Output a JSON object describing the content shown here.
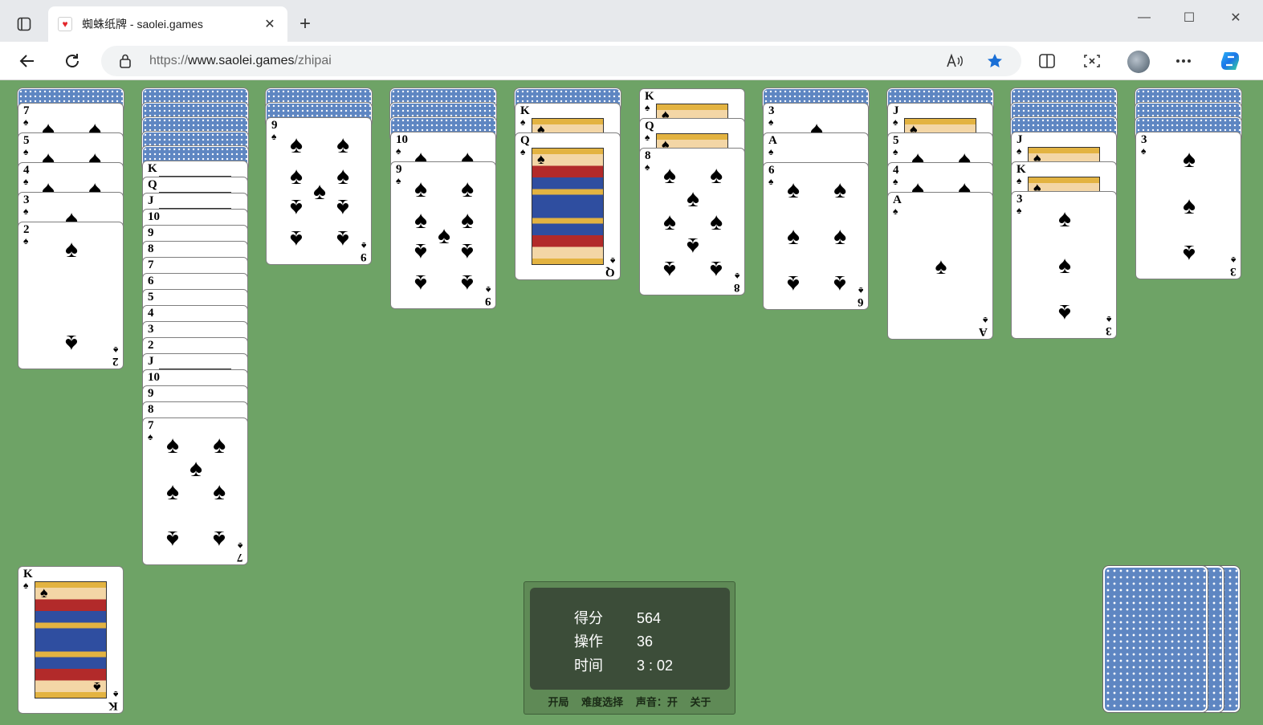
{
  "browser": {
    "tab_title": "蜘蛛纸牌 - saolei.games",
    "tab_close": "✕",
    "new_tab": "+",
    "url_prefix": "https://",
    "url_host": "www.saolei.games",
    "url_path": "/zhipai",
    "window_min": "—",
    "window_max": "☐",
    "window_close": "✕"
  },
  "game": {
    "suit": "♠",
    "columns": [
      {
        "backs": 1,
        "faces": [
          "7",
          "5",
          "4",
          "3",
          "2"
        ]
      },
      {
        "backs": 5,
        "faces": [
          "K",
          "Q",
          "J",
          "10",
          "9",
          "8",
          "7",
          "6",
          "5",
          "4",
          "3",
          "2",
          "J",
          "10",
          "9",
          "8",
          "7"
        ]
      },
      {
        "backs": 2,
        "faces": [
          "9"
        ]
      },
      {
        "backs": 3,
        "faces": [
          "10",
          "9"
        ]
      },
      {
        "backs": 1,
        "faces": [
          "K",
          "Q"
        ]
      },
      {
        "backs": 0,
        "faces": [
          "K",
          "Q",
          "8"
        ]
      },
      {
        "backs": 1,
        "faces": [
          "3",
          "A",
          "6"
        ]
      },
      {
        "backs": 1,
        "faces": [
          "J",
          "5",
          "4",
          "A"
        ]
      },
      {
        "backs": 3,
        "faces": [
          "J",
          "K",
          "3"
        ]
      },
      {
        "backs": 3,
        "faces": [
          "3"
        ]
      }
    ],
    "completed_pile_top": "K",
    "stock_piles": 3
  },
  "score": {
    "score_label": "得分",
    "score_value": "564",
    "moves_label": "操作",
    "moves_value": "36",
    "time_label": "时间",
    "time_value": "3 : 02"
  },
  "menu": {
    "new_game": "开局",
    "difficulty": "难度选择",
    "sound": "声音：开",
    "about": "关于"
  },
  "colors": {
    "felt": "#6ea366",
    "card_back": "#5e86c2",
    "panel": "#3c4d39"
  }
}
